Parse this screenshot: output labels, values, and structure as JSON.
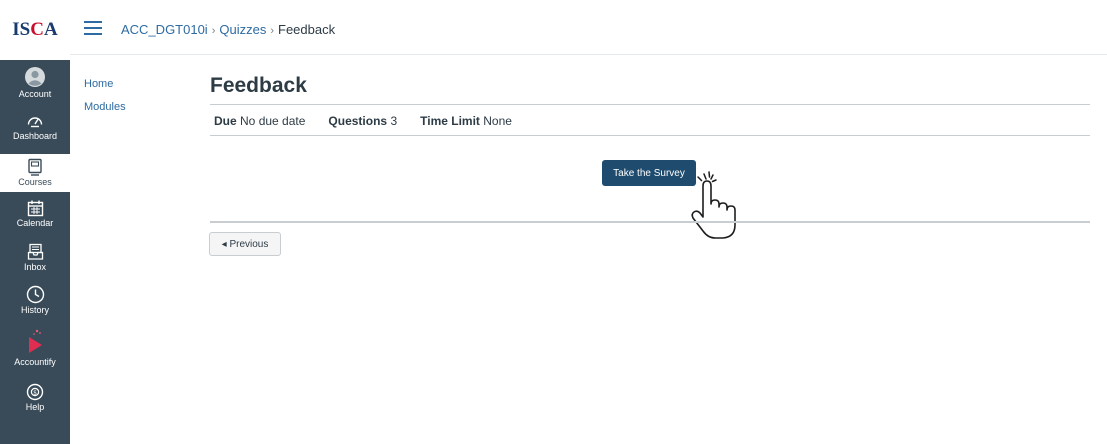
{
  "logo": {
    "text_1": "IS",
    "text_2": "C",
    "text_3": "A"
  },
  "global_nav": [
    {
      "label": "Account",
      "icon": "user-circle-icon"
    },
    {
      "label": "Dashboard",
      "icon": "dashboard-gauge-icon"
    },
    {
      "label": "Courses",
      "icon": "courses-book-icon"
    },
    {
      "label": "Calendar",
      "icon": "calendar-icon"
    },
    {
      "label": "Inbox",
      "icon": "inbox-tray-icon"
    },
    {
      "label": "History",
      "icon": "clock-icon"
    },
    {
      "label": "Accountify",
      "icon": "play-triangle-icon"
    },
    {
      "label": "Help",
      "icon": "help-circle-icon"
    }
  ],
  "breadcrumb": {
    "course": "ACC_DGT010i",
    "section": "Quizzes",
    "page": "Feedback",
    "separator": "›"
  },
  "course_nav": [
    {
      "label": "Home"
    },
    {
      "label": "Modules"
    }
  ],
  "quiz": {
    "title": "Feedback",
    "due_label": "Due",
    "due_value": "No due date",
    "questions_label": "Questions",
    "questions_value": "3",
    "time_limit_label": "Time Limit",
    "time_limit_value": "None"
  },
  "actions": {
    "take_survey": "Take the Survey",
    "previous": "◂ Previous"
  },
  "colors": {
    "nav_bg": "#394b58",
    "primary_button": "#1e4b6e",
    "link": "#2d6ba3",
    "accent": "#e02d52"
  }
}
